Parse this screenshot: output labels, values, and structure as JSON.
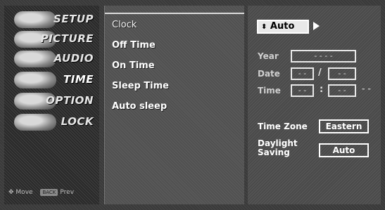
{
  "rail": {
    "tabs": [
      {
        "label": "SETUP",
        "icon": "setup-icon"
      },
      {
        "label": "PICTURE",
        "icon": "picture-icon"
      },
      {
        "label": "AUDIO",
        "icon": "audio-icon"
      },
      {
        "label": "TIME",
        "icon": "time-icon"
      },
      {
        "label": "OPTION",
        "icon": "option-icon"
      },
      {
        "label": "LOCK",
        "icon": "lock-icon"
      }
    ],
    "hint_move": "Move",
    "hint_back_badge": "BACK",
    "hint_prev": "Prev"
  },
  "menu": {
    "items": [
      "Clock",
      "Off Time",
      "On Time",
      "Sleep Time",
      "Auto sleep"
    ]
  },
  "panel": {
    "mode_value": "Auto",
    "year_label": "Year",
    "year_value": "- - - -",
    "date_label": "Date",
    "date_month": "- -",
    "date_sep": "/",
    "date_day": "- -",
    "time_label": "Time",
    "time_hour": "- -",
    "time_sep": ":",
    "time_min": "- -",
    "time_ampm": "- -",
    "timezone_label": "Time Zone",
    "timezone_value": "Eastern",
    "daylight_label_1": "Daylight",
    "daylight_label_2": "Saving",
    "daylight_value": "Auto"
  }
}
